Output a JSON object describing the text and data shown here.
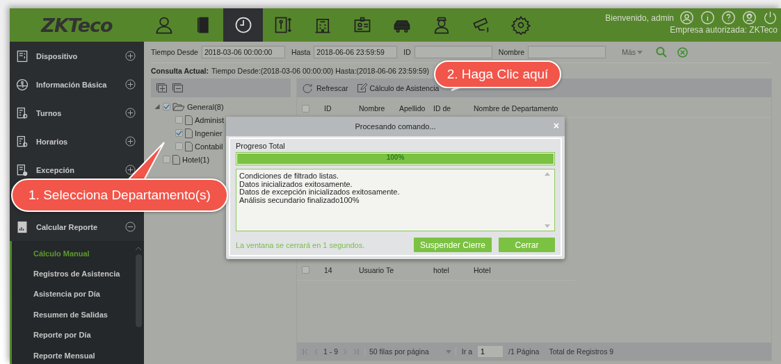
{
  "header": {
    "logo": "ZKTeco",
    "modules": [
      {
        "selected": false
      },
      {
        "selected": false
      },
      {
        "selected": true
      },
      {
        "selected": false
      },
      {
        "selected": false
      },
      {
        "selected": false
      },
      {
        "selected": false
      },
      {
        "selected": false
      },
      {
        "selected": false
      },
      {
        "selected": false
      }
    ],
    "welcome": "Bienvenido, admin",
    "company": "Empresa autorizada: ZKTeco"
  },
  "sidebar": {
    "items": [
      {
        "label": "Dispositivo",
        "expanded": false
      },
      {
        "label": "Información Básica",
        "expanded": false
      },
      {
        "label": "Turnos",
        "expanded": false
      },
      {
        "label": "Horarios",
        "expanded": false
      },
      {
        "label": "Excepción",
        "expanded": false
      },
      {
        "label": "Calcular Reporte",
        "expanded": true,
        "children": [
          {
            "label": "Cálculo Manual",
            "selected": true
          },
          {
            "label": "Registros de Asistencia",
            "selected": false
          },
          {
            "label": "Asistencia por Día",
            "selected": false
          },
          {
            "label": "Resumen de Salidas",
            "selected": false
          },
          {
            "label": "Reporte por Día",
            "selected": false
          },
          {
            "label": "Reporte Mensual",
            "selected": false
          }
        ]
      }
    ]
  },
  "filters": {
    "fields": [
      {
        "label": "Tiempo Desde",
        "value": "2018-03-06 00:00:00"
      },
      {
        "label": "Hasta",
        "value": "2018-06-06 23:59:59"
      },
      {
        "label": "ID"
      },
      {
        "label": "Nombre"
      }
    ],
    "more": "Más"
  },
  "query": {
    "label": "Consulta Actual:",
    "text": "Tiempo Desde:(2018-03-06 00:00:00) Hasta:(2018-06-06 23:59:59)"
  },
  "tree": {
    "nodes": [
      {
        "label": "General(8)",
        "checked": true,
        "expanded": true,
        "children": [
          {
            "label": "Administ",
            "checked": false
          },
          {
            "label": "Ingenier",
            "checked": true
          },
          {
            "label": "Contabil",
            "checked": false
          }
        ]
      },
      {
        "label": "Hotel(1)",
        "checked": false
      }
    ]
  },
  "toolbar": {
    "buttons": [
      "Refrescar",
      "Cálculo de Asistencia"
    ]
  },
  "table": {
    "header_checked": false,
    "columns": [
      "ID",
      "Nombre",
      "Apellido",
      "ID de",
      "Nombre de Departamento"
    ],
    "rows": [
      {
        "checked": false,
        "cells": [
          "14",
          "Usuario Te",
          "",
          "hotel",
          "Hotel"
        ]
      }
    ]
  },
  "pagination": {
    "range": "1 - 9",
    "page_size": "50 filas por página",
    "goto_label": "Ir a",
    "page": "1",
    "pages": "/1 Página",
    "total": "Total de Registros 9"
  },
  "dialog": {
    "title": "Procesando comando...",
    "close": "×",
    "progress_label": "Progreso Total",
    "level": 1,
    "percent": "100%",
    "log": [
      "Condiciones de filtrado listas.",
      "Datos inicializados exitosamente.",
      "Datos de excepción inicializados exitosamente.",
      "Análisis secundario finalizado100%"
    ],
    "countdown": "La ventana se cerrará en 1 segundos.",
    "buttons": [
      "Suspender Cierre",
      "Cerrar"
    ]
  },
  "callouts": [
    "1. Selecciona Departamento(s)",
    "2. Haga Clic aquí"
  ]
}
